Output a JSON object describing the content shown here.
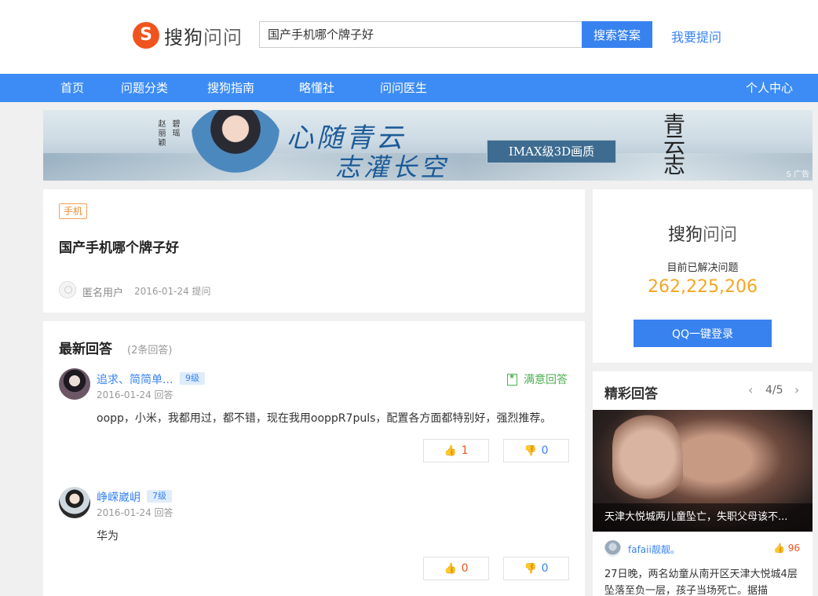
{
  "header": {
    "logo_mark": "S",
    "logo_text_bold": "搜狗",
    "logo_text_thin": "问问",
    "search_value": "国产手机哪个牌子好",
    "search_button": "搜索答案",
    "ask_link": "我要提问"
  },
  "nav": {
    "items": [
      {
        "label": "首页"
      },
      {
        "label": "问题分类"
      },
      {
        "label": "搜狗指南"
      },
      {
        "label": "略懂社"
      },
      {
        "label": "问问医生"
      }
    ],
    "user_center": "个人中心"
  },
  "banner": {
    "name1": "赵丽颖",
    "name2": "碧瑶",
    "slogan1": "心随青云",
    "slogan2": "志灌长空",
    "badge": "IMAX级3D画质",
    "brand": "青云志",
    "ad_label": "S 广告"
  },
  "question": {
    "tag": "手机",
    "title": "国产手机哪个牌子好",
    "user": "匿名用户",
    "date": "2016-01-24 提问"
  },
  "answers": {
    "heading": "最新回答",
    "count": "(2条回答)",
    "items": [
      {
        "name": "追求、简简单...",
        "level": "9级",
        "date": "2016-01-24 回答",
        "text": "oopp，小米，我都用过，都不错，现在我用ooppR7puls，配置各方面都特别好，强烈推荐。",
        "satisfied": "满意回答",
        "up": "1",
        "down": "0"
      },
      {
        "name": "峥嵘崴岄",
        "level": "7级",
        "date": "2016-01-24 回答",
        "text": "华为",
        "up": "0",
        "down": "0"
      }
    ]
  },
  "stats": {
    "title_bold": "搜狗",
    "title_thin": "问问",
    "label": "目前已解决问题",
    "number": "262,225,206",
    "login_button": "QQ一键登录"
  },
  "featured": {
    "heading": "精彩回答",
    "page": "4/5",
    "caption": "天津大悦城两儿童坠亡，失职父母该不...",
    "user": "fafaii靓靓。",
    "likes": "96",
    "text": "27日晚，两名幼童从南开区天津大悦城4层坠落至负一层，孩子当场死亡。据描"
  },
  "colors": {
    "brand_blue": "#3882f0",
    "nav_blue": "#3d8cf5",
    "orange": "#f5a623",
    "like_red": "#f0541e",
    "satisfied_green": "#4caf50"
  },
  "icons": {
    "thumb_up": "👍",
    "thumb_down": "👎",
    "prev": "‹",
    "next": "›"
  }
}
